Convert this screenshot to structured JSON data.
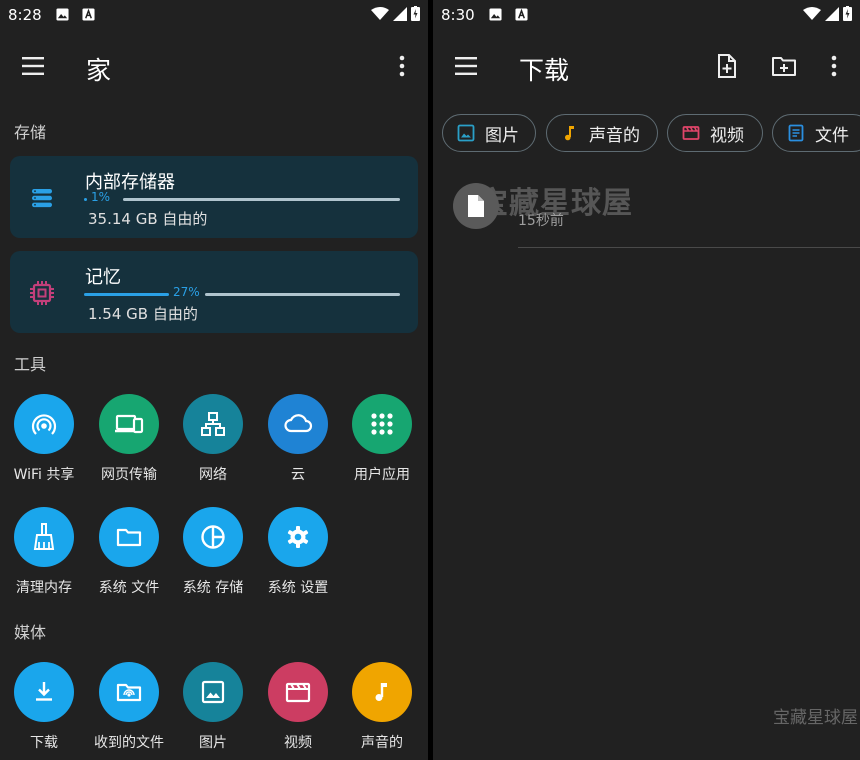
{
  "left": {
    "status": {
      "time": "8:28"
    },
    "appbar": {
      "title": "家"
    },
    "storage_label": "存储",
    "internal": {
      "name": "内部存储器",
      "percent_text": "1%",
      "percent": 0.01,
      "free": "35.14 GB 自由的"
    },
    "memory": {
      "name": "记忆",
      "percent_text": "27%",
      "percent": 0.27,
      "free": "1.54 GB 自由的"
    },
    "tools_label": "工具",
    "tools": [
      {
        "label": "WiFi 共享",
        "icon": "wifi-share-icon",
        "color": "#1aa6ec"
      },
      {
        "label": "网页传输",
        "icon": "web-transfer-icon",
        "color": "#17a671"
      },
      {
        "label": "网络",
        "icon": "network-icon",
        "color": "#16839a"
      },
      {
        "label": "云",
        "icon": "cloud-icon",
        "color": "#1f83d4"
      },
      {
        "label": "用户应用",
        "icon": "apps-grid-icon",
        "color": "#17a671"
      },
      {
        "label": "清理内存",
        "icon": "broom-icon",
        "color": "#1aa6ec"
      },
      {
        "label": "系统 文件",
        "icon": "folder-icon",
        "color": "#1aa6ec"
      },
      {
        "label": "系统 存储",
        "icon": "pie-chart-icon",
        "color": "#1aa6ec"
      },
      {
        "label": "系统 设置",
        "icon": "gear-icon",
        "color": "#1aa6ec"
      }
    ],
    "media_label": "媒体",
    "media": [
      {
        "label": "下载",
        "icon": "download-icon",
        "color": "#1aa6ec"
      },
      {
        "label": "收到的文件",
        "icon": "received-files-icon",
        "color": "#1aa6ec"
      },
      {
        "label": "图片",
        "icon": "image-icon",
        "color": "#16839a"
      },
      {
        "label": "视频",
        "icon": "video-icon",
        "color": "#cc3d62"
      },
      {
        "label": "声音的",
        "icon": "music-note-icon",
        "color": "#f0a500"
      }
    ]
  },
  "right": {
    "status": {
      "time": "8:30"
    },
    "appbar": {
      "title": "下载"
    },
    "chips": [
      {
        "label": "图片",
        "icon": "image-icon",
        "color": "#2aa0c8"
      },
      {
        "label": "声音的",
        "icon": "music-note-icon",
        "color": "#f0a500"
      },
      {
        "label": "视频",
        "icon": "video-icon",
        "color": "#e0456a"
      },
      {
        "label": "文件",
        "icon": "document-icon",
        "color": "#2a8fe0"
      }
    ],
    "file": {
      "meta": "15秒前"
    },
    "watermark_main": "宝藏星球屋",
    "watermark_corner": "宝藏星球屋"
  }
}
